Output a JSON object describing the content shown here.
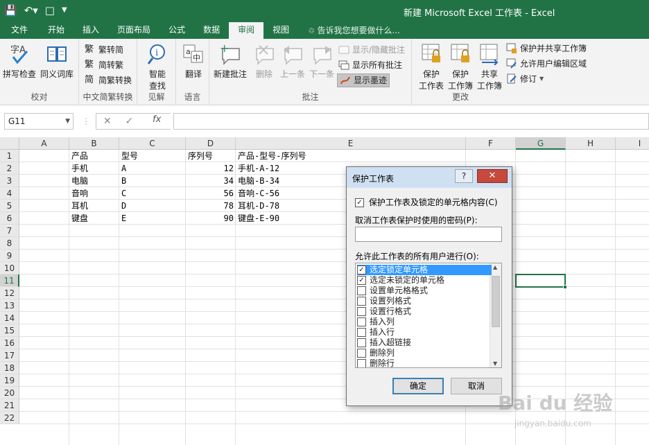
{
  "titlebar": {
    "window_title": "新建 Microsoft Excel 工作表 - Excel",
    "bg_color": "#217346",
    "qat_icons": [
      "save-icon",
      "undo-icon",
      "new-document-icon",
      "customize-qat-icon"
    ]
  },
  "tabs": [
    {
      "label": "文件"
    },
    {
      "label": "开始"
    },
    {
      "label": "插入"
    },
    {
      "label": "页面布局"
    },
    {
      "label": "公式"
    },
    {
      "label": "数据"
    },
    {
      "label": "审阅",
      "active": true
    },
    {
      "label": "视图"
    }
  ],
  "tell_me": "告诉我您想要做什么...",
  "ribbon": {
    "proofing": {
      "label": "校对",
      "spelling": "拼写检查",
      "thesaurus": "同义词库"
    },
    "chinese": {
      "label": "中文简繁转换",
      "to_simplified": "繁转简",
      "to_traditional": "简转繁",
      "convert": "简繁转换"
    },
    "insights": {
      "label": "见解",
      "smart_lookup_line1": "智能",
      "smart_lookup_line2": "查找"
    },
    "language": {
      "label": "语言",
      "translate": "翻译"
    },
    "comments": {
      "label": "批注",
      "new": "新建批注",
      "delete": "删除",
      "prev": "上一条",
      "next": "下一条",
      "show_hide": "显示/隐藏批注",
      "show_all": "显示所有批注",
      "show_ink": "显示墨迹"
    },
    "changes": {
      "label": "更改",
      "protect_sheet_l1": "保护",
      "protect_sheet_l2": "工作表",
      "protect_wb_l1": "保护",
      "protect_wb_l2": "工作簿",
      "share_wb_l1": "共享",
      "share_wb_l2": "工作簿",
      "protect_share": "保护并共享工作簿",
      "allow_edit": "允许用户编辑区域",
      "track": "修订"
    }
  },
  "formula_bar": {
    "name_box": "G11",
    "fx": "fx",
    "value": ""
  },
  "grid": {
    "columns": [
      "A",
      "B",
      "C",
      "D",
      "E",
      "F",
      "G",
      "H",
      "I"
    ],
    "rows": [
      "1",
      "2",
      "3",
      "4",
      "5",
      "6",
      "7",
      "8",
      "9",
      "10",
      "11",
      "12",
      "13",
      "14",
      "15",
      "16",
      "17",
      "18",
      "19",
      "20",
      "21",
      "22"
    ],
    "selected_col": "G",
    "selected_row": "11",
    "headers": {
      "B": "产品",
      "C": "型号",
      "D": "序列号",
      "E": "产品-型号-序列号"
    },
    "data": [
      {
        "B": "手机",
        "C": "A",
        "D": "12",
        "E": "手机-A-12"
      },
      {
        "B": "电脑",
        "C": "B",
        "D": "34",
        "E": "电脑-B-34"
      },
      {
        "B": "音响",
        "C": "C",
        "D": "56",
        "E": "音响-C-56"
      },
      {
        "B": "耳机",
        "C": "D",
        "D": "78",
        "E": "耳机-D-78"
      },
      {
        "B": "键盘",
        "C": "E",
        "D": "90",
        "E": "键盘-E-90"
      }
    ]
  },
  "dialog": {
    "title": "保护工作表",
    "help": "?",
    "close": "✕",
    "protect_label": "保护工作表及锁定的单元格内容(C)",
    "protect_checked": true,
    "password_label": "取消工作表保护时使用的密码(P):",
    "password_value": "",
    "allow_label": "允许此工作表的所有用户进行(O):",
    "permissions": [
      {
        "label": "选定锁定单元格",
        "checked": true,
        "highlighted": true
      },
      {
        "label": "选定未锁定的单元格",
        "checked": true
      },
      {
        "label": "设置单元格格式",
        "checked": false
      },
      {
        "label": "设置列格式",
        "checked": false
      },
      {
        "label": "设置行格式",
        "checked": false
      },
      {
        "label": "插入列",
        "checked": false
      },
      {
        "label": "插入行",
        "checked": false
      },
      {
        "label": "插入超链接",
        "checked": false
      },
      {
        "label": "删除列",
        "checked": false
      },
      {
        "label": "删除行",
        "checked": false
      }
    ],
    "ok": "确定",
    "cancel": "取消"
  },
  "watermark": {
    "main": "Bai du 经验",
    "sub": "jingyan.baidu.com"
  }
}
